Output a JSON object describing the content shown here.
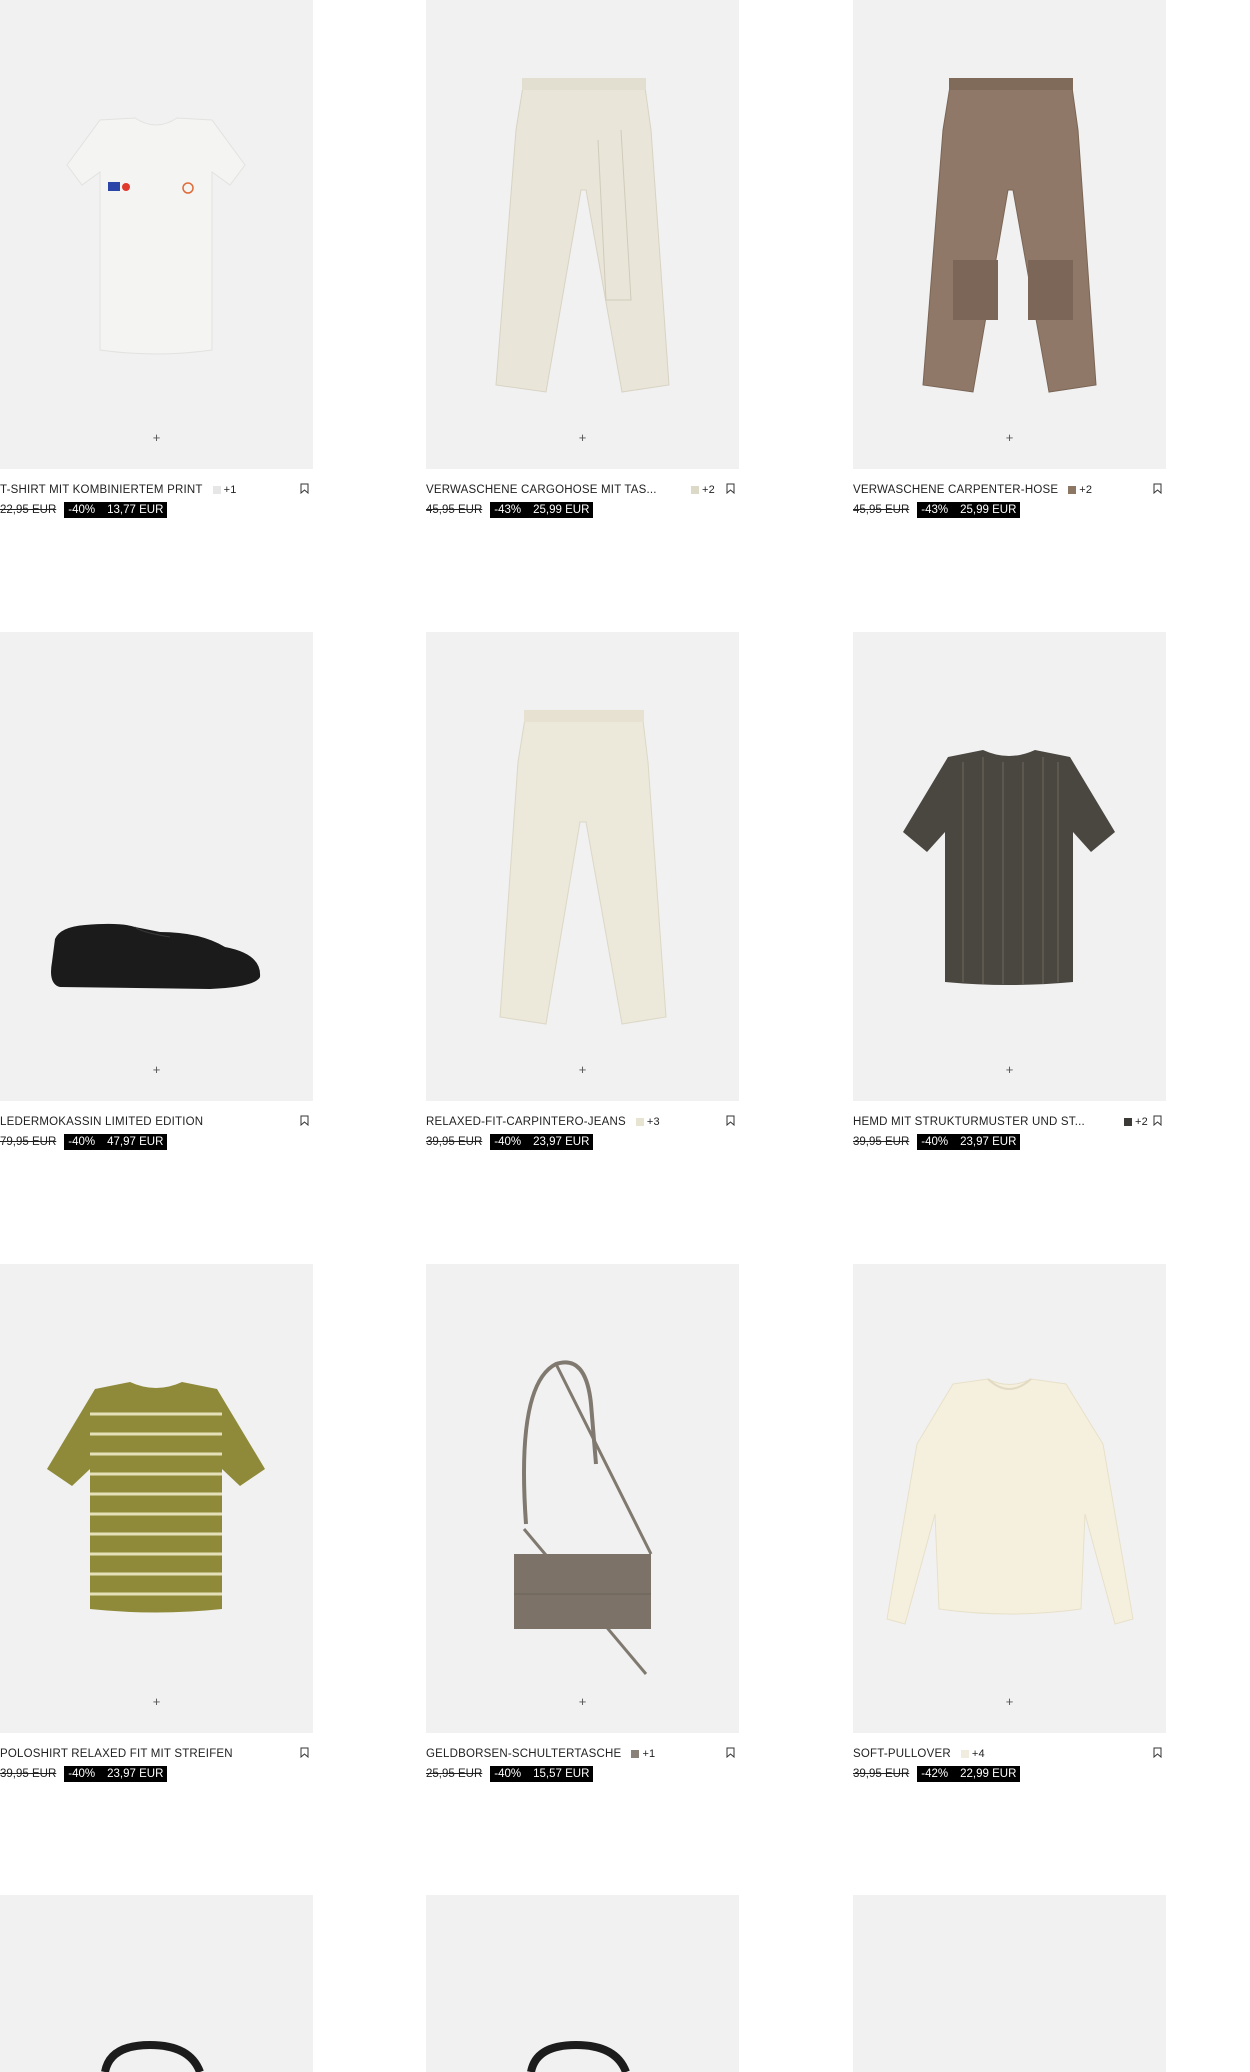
{
  "products": [
    {
      "name": "T-SHIRT MIT KOMBINIERTEM PRINT",
      "swatch_color": "#e6e6e6",
      "swatch_extra": "+1",
      "old_price": "22,95 EUR",
      "discount": "-40%",
      "new_price": "13,77 EUR",
      "add_icon": "plus-icon",
      "image": "white-tshirt"
    },
    {
      "name": "VERWASCHENE CARGOHOSE MIT TAS...",
      "swatch_color": "#dcd9c9",
      "swatch_extra": "+2",
      "old_price": "45,95 EUR",
      "discount": "-43%",
      "new_price": "25,99 EUR",
      "add_icon": "plus-icon",
      "image": "cream-cargo-pants"
    },
    {
      "name": "VERWASCHENE CARPENTER-HOSE",
      "swatch_color": "#8c7664",
      "swatch_extra": "+2",
      "old_price": "45,95 EUR",
      "discount": "-43%",
      "new_price": "25,99 EUR",
      "add_icon": "plus-icon",
      "image": "brown-carpenter-pants"
    },
    {
      "name": "LEDERMOKASSIN LIMITED EDITION",
      "swatch_color": "",
      "swatch_extra": "",
      "old_price": "79,95 EUR",
      "discount": "-40%",
      "new_price": "47,97 EUR",
      "add_icon": "plus-icon",
      "image": "black-loafer"
    },
    {
      "name": "RELAXED-FIT-CARPINTERO-JEANS",
      "swatch_color": "#e8e4d2",
      "swatch_extra": "+3",
      "old_price": "39,95 EUR",
      "discount": "-40%",
      "new_price": "23,97 EUR",
      "add_icon": "plus-icon",
      "image": "cream-jeans"
    },
    {
      "name": "HEMD MIT STRUKTURMUSTER UND ST...",
      "swatch_color": "#3b3a36",
      "swatch_extra": "+2",
      "old_price": "39,95 EUR",
      "discount": "-40%",
      "new_price": "23,97 EUR",
      "add_icon": "plus-icon",
      "image": "striped-shirt"
    },
    {
      "name": "POLOSHIRT RELAXED FIT MIT STREIFEN",
      "swatch_color": "",
      "swatch_extra": "",
      "old_price": "39,95 EUR",
      "discount": "-40%",
      "new_price": "23,97 EUR",
      "add_icon": "plus-icon",
      "image": "striped-polo"
    },
    {
      "name": "GELDBÖRSEN-SCHULTERTASCHE",
      "swatch_color": "#8a8278",
      "swatch_extra": "+1",
      "old_price": "25,95 EUR",
      "discount": "-40%",
      "new_price": "15,57 EUR",
      "add_icon": "plus-icon",
      "image": "shoulder-bag"
    },
    {
      "name": "SOFT-PULLOVER",
      "swatch_color": "#f0ede0",
      "swatch_extra": "+4",
      "old_price": "39,95 EUR",
      "discount": "-42%",
      "new_price": "22,99 EUR",
      "add_icon": "plus-icon",
      "image": "cream-pullover"
    },
    {
      "name": "",
      "image": "partial-1"
    },
    {
      "name": "",
      "image": "partial-2"
    },
    {
      "name": "",
      "image": "partial-3"
    }
  ],
  "icons": {
    "bookmark": "bookmark-icon",
    "add": "plus-icon"
  },
  "colors": {
    "tile_bg": "#f1f1f1",
    "sale_bg": "#000000",
    "sale_text": "#ffffff"
  }
}
